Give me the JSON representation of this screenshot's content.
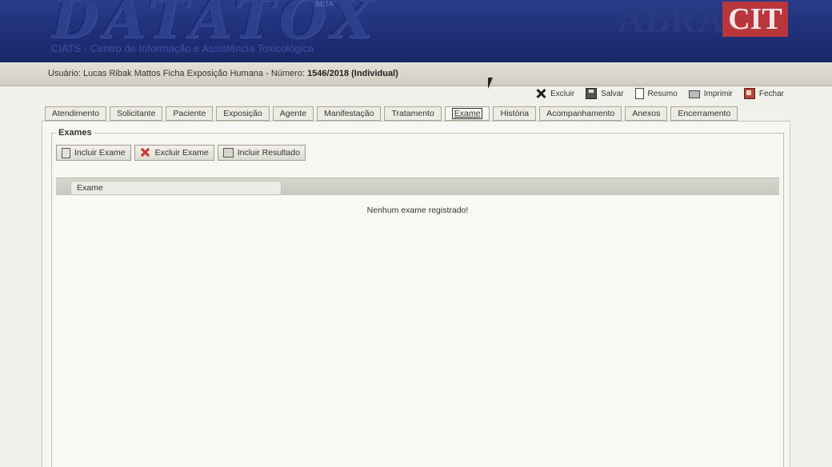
{
  "header": {
    "logo": "DATATOX",
    "logo_beta": "BETA",
    "logo_subtitle": "CIATS · Centro de Informação e Assistência Toxicológica",
    "brand_left": "ABRA",
    "brand_right": "CIT",
    "brand_color": "#b8363c"
  },
  "infobar": {
    "user_label": "Usuário:",
    "user_name": "Lucas Ribak Mattos",
    "form_label": "Ficha Exposição Humana - Número:",
    "form_number": "1546/2018 (Individual)"
  },
  "toolbar": {
    "excluir": "Excluir",
    "salvar": "Salvar",
    "resumo": "Resumo",
    "imprimir": "Imprimir",
    "fechar": "Fechar"
  },
  "tabs": [
    {
      "label": "Atendimento"
    },
    {
      "label": "Solicitante"
    },
    {
      "label": "Paciente"
    },
    {
      "label": "Exposição"
    },
    {
      "label": "Agente"
    },
    {
      "label": "Manifestação"
    },
    {
      "label": "Tratamento"
    },
    {
      "label": "Exame"
    },
    {
      "label": "História"
    },
    {
      "label": "Acompanhamento"
    },
    {
      "label": "Anexos"
    },
    {
      "label": "Encerramento"
    }
  ],
  "section": {
    "legend": "Exames",
    "buttons": {
      "incluir_exame": "Incluir Exame",
      "excluir_exame": "Excluir Exame",
      "incluir_resultado": "Incluir Resultado"
    },
    "table": {
      "column": "Exame",
      "empty_message": "Nenhum exame registrado!"
    }
  }
}
